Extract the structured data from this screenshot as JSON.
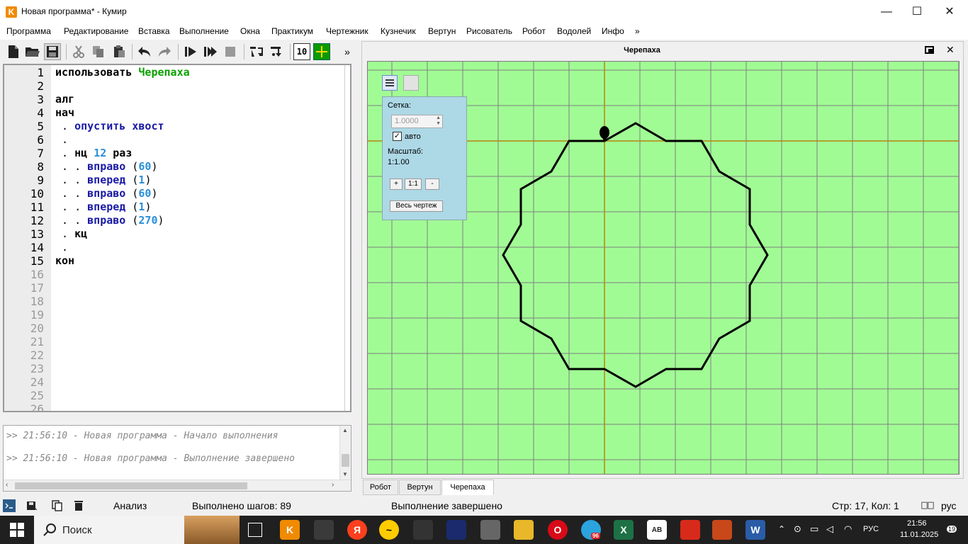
{
  "window": {
    "app_icon_letter": "K",
    "title": "Новая программа* - Кумир",
    "minimize": "—",
    "maximize": "☐",
    "close": "✕"
  },
  "menu": [
    "Программа",
    "Редактирование",
    "Вставка",
    "Выполнение",
    "Окна",
    "Практикум",
    "Чертежник",
    "Кузнечик",
    "Вертун",
    "Рисователь",
    "Робот",
    "Водолей",
    "Инфо",
    "»"
  ],
  "toolbar": {
    "more": "»",
    "counter_label": "10"
  },
  "editor": {
    "line_numbers": [
      "1",
      "2",
      "3",
      "4",
      "5",
      "6",
      "7",
      "8",
      "9",
      "10",
      "11",
      "12",
      "13",
      "14",
      "15",
      "16",
      "17",
      "18",
      "19",
      "20",
      "21",
      "22",
      "23",
      "24",
      "25",
      "26"
    ],
    "lines": [
      {
        "parts": [
          {
            "t": "использовать ",
            "c": "kw"
          },
          {
            "t": "Черепаха",
            "c": "mod"
          }
        ]
      },
      {
        "parts": []
      },
      {
        "parts": [
          {
            "t": "алг",
            "c": "kw"
          }
        ]
      },
      {
        "parts": [
          {
            "t": "нач",
            "c": "kw"
          }
        ]
      },
      {
        "parts": [
          {
            "t": " . ",
            "c": "punc"
          },
          {
            "t": "опустить хвост",
            "c": "cmd"
          }
        ]
      },
      {
        "parts": [
          {
            "t": " .",
            "c": "punc"
          }
        ]
      },
      {
        "parts": [
          {
            "t": " . ",
            "c": "punc"
          },
          {
            "t": "нц ",
            "c": "kw"
          },
          {
            "t": "12",
            "c": "num"
          },
          {
            "t": " раз",
            "c": "kw"
          }
        ]
      },
      {
        "parts": [
          {
            "t": " . . ",
            "c": "punc"
          },
          {
            "t": "вправо",
            "c": "cmd"
          },
          {
            "t": " (",
            "c": "punc"
          },
          {
            "t": "60",
            "c": "num"
          },
          {
            "t": ")",
            "c": "punc"
          }
        ]
      },
      {
        "parts": [
          {
            "t": " . . ",
            "c": "punc"
          },
          {
            "t": "вперед",
            "c": "cmd"
          },
          {
            "t": " (",
            "c": "punc"
          },
          {
            "t": "1",
            "c": "num"
          },
          {
            "t": ")",
            "c": "punc"
          }
        ]
      },
      {
        "parts": [
          {
            "t": " . . ",
            "c": "punc"
          },
          {
            "t": "вправо",
            "c": "cmd"
          },
          {
            "t": " (",
            "c": "punc"
          },
          {
            "t": "60",
            "c": "num"
          },
          {
            "t": ")",
            "c": "punc"
          }
        ]
      },
      {
        "parts": [
          {
            "t": " . . ",
            "c": "punc"
          },
          {
            "t": "вперед",
            "c": "cmd"
          },
          {
            "t": " (",
            "c": "punc"
          },
          {
            "t": "1",
            "c": "num"
          },
          {
            "t": ")",
            "c": "punc"
          }
        ]
      },
      {
        "parts": [
          {
            "t": " . . ",
            "c": "punc"
          },
          {
            "t": "вправо",
            "c": "cmd"
          },
          {
            "t": " (",
            "c": "punc"
          },
          {
            "t": "270",
            "c": "num"
          },
          {
            "t": ")",
            "c": "punc"
          }
        ]
      },
      {
        "parts": [
          {
            "t": " . ",
            "c": "punc"
          },
          {
            "t": "кц",
            "c": "kw"
          }
        ]
      },
      {
        "parts": [
          {
            "t": " .",
            "c": "punc"
          }
        ]
      },
      {
        "parts": [
          {
            "t": "кон",
            "c": "kw"
          }
        ]
      }
    ]
  },
  "console": {
    "lines": [
      ">> 21:56:10 - Новая программа - Начало выполнения",
      ">> 21:56:10 - Новая программа - Выполнение завершено"
    ]
  },
  "turtle": {
    "title": "Черепаха",
    "grid_label": "Сетка:",
    "grid_value": "1.0000",
    "auto_label": "авто",
    "auto_checked": true,
    "scale_label": "Масштаб:",
    "scale_value": "1:1.00",
    "zoom_in": "+",
    "zoom_reset": "1:1",
    "zoom_out": "-",
    "fit_all": "Весь чертеж",
    "canvas_color": "#a1fb95",
    "grid_color": "#808080",
    "axis_color": "#b8860b"
  },
  "tabs": [
    "Робот",
    "Вертун",
    "Черепаха"
  ],
  "active_tab": "Черепаха",
  "status": {
    "analysis": "Анализ",
    "steps": "Выполнено шагов: 89",
    "state": "Выполнение завершено",
    "cursor": "Стр: 17, Кол: 1",
    "lang": "рус"
  },
  "taskbar": {
    "search_label": "Поиск",
    "lang": "РУС",
    "time": "21:56",
    "date": "11.01.2025",
    "notifications": "19",
    "badge": "96"
  }
}
